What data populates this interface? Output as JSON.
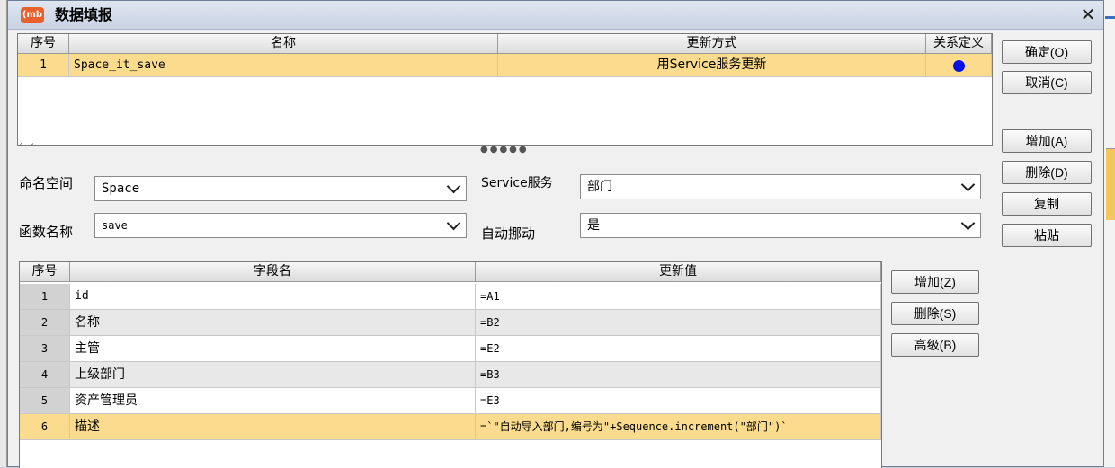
{
  "window": {
    "title": "数据填报",
    "app_icon_label": "(mb",
    "close_icon": "close-icon"
  },
  "top_table": {
    "headers": [
      "序号",
      "名称",
      "更新方式",
      "关系定义"
    ],
    "rows": [
      {
        "index": "1",
        "name": "Space_it_save",
        "update_mode": "用Service服务更新",
        "relation": "blue-dot-icon"
      }
    ]
  },
  "right_buttons": {
    "ok": "确定(O)",
    "cancel": "取消(C)",
    "add": "增加(A)",
    "delete": "删除(D)",
    "copy": "复制",
    "paste": "粘贴"
  },
  "form": {
    "namespace_label": "命名空间",
    "namespace_value": "Space",
    "service_label": "Service服务",
    "service_value": "部门",
    "function_label": "函数名称",
    "function_value": "save",
    "auto_move_label": "自动挪动",
    "auto_move_value": "是"
  },
  "field_table": {
    "headers": [
      "序号",
      "字段名",
      "更新值"
    ],
    "rows": [
      {
        "index": "1",
        "field": "id",
        "value": "=A1"
      },
      {
        "index": "2",
        "field": "名称",
        "value": "=B2"
      },
      {
        "index": "3",
        "field": "主管",
        "value": "=E2"
      },
      {
        "index": "4",
        "field": "上级部门",
        "value": "=B3"
      },
      {
        "index": "5",
        "field": "资产管理员",
        "value": "=E3"
      },
      {
        "index": "6",
        "field": "描述",
        "value": "=`\"自动导入部门,编号为\"+Sequence.increment(\"部门\")`"
      }
    ],
    "selected_row": "6"
  },
  "field_buttons": {
    "add": "增加(Z)",
    "delete": "删除(S)",
    "advanced": "高级(B)"
  },
  "colors": {
    "selected_row": "#fbdc8e",
    "relation_dot": "#0010e6",
    "app_icon": "#e8602c"
  }
}
